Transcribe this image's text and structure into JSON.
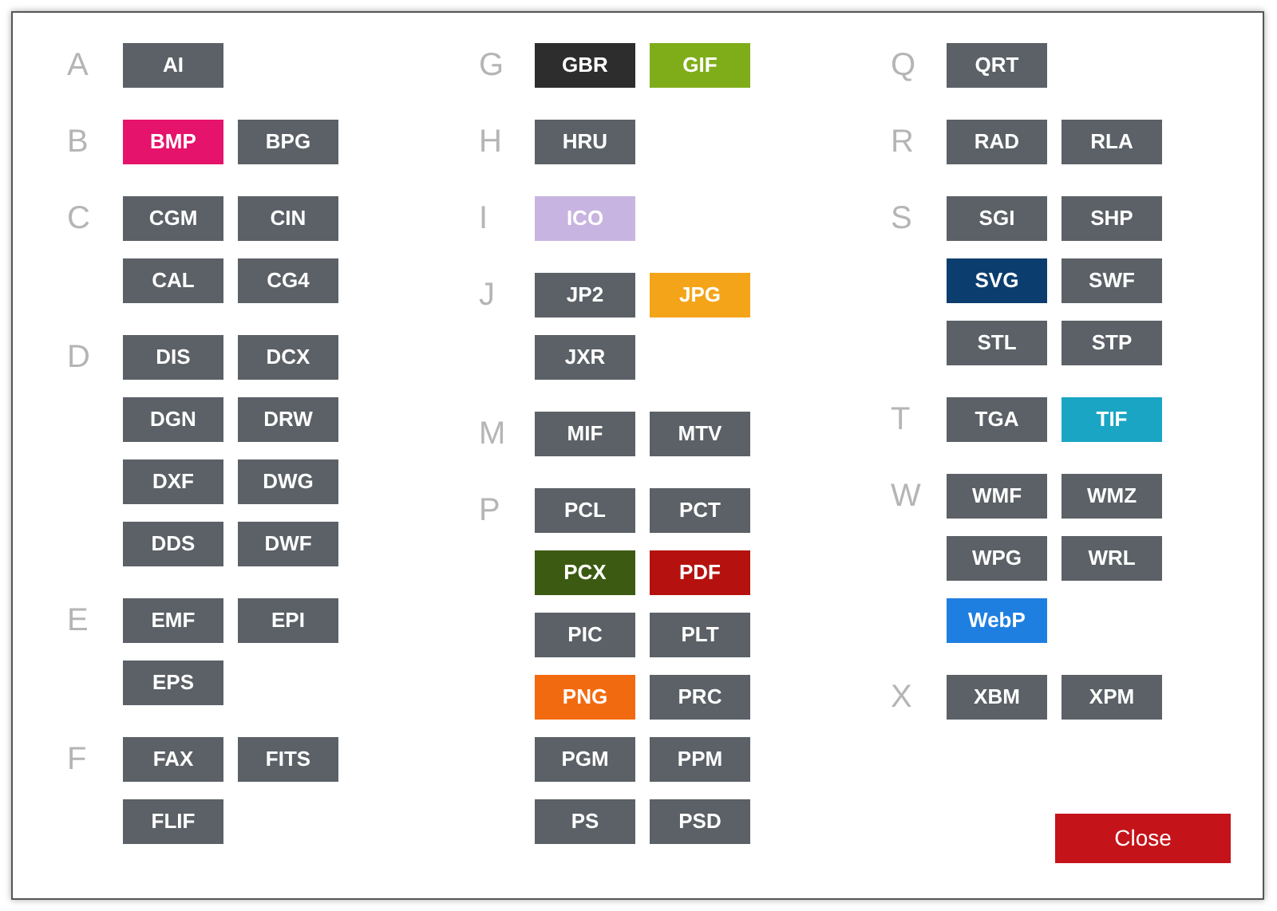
{
  "columns": [
    {
      "groups": [
        {
          "letter": "A",
          "formats": [
            {
              "label": "AI",
              "color": "#5b6166"
            }
          ]
        },
        {
          "letter": "B",
          "formats": [
            {
              "label": "BMP",
              "color": "#e5136b"
            },
            {
              "label": "BPG",
              "color": "#5b6166"
            }
          ]
        },
        {
          "letter": "C",
          "formats": [
            {
              "label": "CGM",
              "color": "#5b6166"
            },
            {
              "label": "CIN",
              "color": "#5b6166"
            },
            {
              "label": "CAL",
              "color": "#5b6166"
            },
            {
              "label": "CG4",
              "color": "#5b6166"
            }
          ]
        },
        {
          "letter": "D",
          "formats": [
            {
              "label": "DIS",
              "color": "#5b6166"
            },
            {
              "label": "DCX",
              "color": "#5b6166"
            },
            {
              "label": "DGN",
              "color": "#5b6166"
            },
            {
              "label": "DRW",
              "color": "#5b6166"
            },
            {
              "label": "DXF",
              "color": "#5b6166"
            },
            {
              "label": "DWG",
              "color": "#5b6166"
            },
            {
              "label": "DDS",
              "color": "#5b6166"
            },
            {
              "label": "DWF",
              "color": "#5b6166"
            }
          ]
        },
        {
          "letter": "E",
          "formats": [
            {
              "label": "EMF",
              "color": "#5b6166"
            },
            {
              "label": "EPI",
              "color": "#5b6166"
            },
            {
              "label": "EPS",
              "color": "#5b6166"
            }
          ]
        },
        {
          "letter": "F",
          "formats": [
            {
              "label": "FAX",
              "color": "#5b6166"
            },
            {
              "label": "FITS",
              "color": "#5b6166"
            },
            {
              "label": "FLIF",
              "color": "#5b6166"
            }
          ]
        }
      ]
    },
    {
      "groups": [
        {
          "letter": "G",
          "formats": [
            {
              "label": "GBR",
              "color": "#2d2d2d"
            },
            {
              "label": "GIF",
              "color": "#7fad1a"
            }
          ]
        },
        {
          "letter": "H",
          "formats": [
            {
              "label": "HRU",
              "color": "#5b6166"
            }
          ]
        },
        {
          "letter": "I",
          "formats": [
            {
              "label": "ICO",
              "color": "#c8b4e0"
            }
          ]
        },
        {
          "letter": "J",
          "formats": [
            {
              "label": "JP2",
              "color": "#5b6166"
            },
            {
              "label": "JPG",
              "color": "#f4a419"
            },
            {
              "label": "JXR",
              "color": "#5b6166"
            }
          ]
        },
        {
          "letter": "M",
          "formats": [
            {
              "label": "MIF",
              "color": "#5b6166"
            },
            {
              "label": "MTV",
              "color": "#5b6166"
            }
          ]
        },
        {
          "letter": "P",
          "formats": [
            {
              "label": "PCL",
              "color": "#5b6166"
            },
            {
              "label": "PCT",
              "color": "#5b6166"
            },
            {
              "label": "PCX",
              "color": "#3c5a12"
            },
            {
              "label": "PDF",
              "color": "#b5120f"
            },
            {
              "label": "PIC",
              "color": "#5b6166"
            },
            {
              "label": "PLT",
              "color": "#5b6166"
            },
            {
              "label": "PNG",
              "color": "#f26a0f"
            },
            {
              "label": "PRC",
              "color": "#5b6166"
            },
            {
              "label": "PGM",
              "color": "#5b6166"
            },
            {
              "label": "PPM",
              "color": "#5b6166"
            },
            {
              "label": "PS",
              "color": "#5b6166"
            },
            {
              "label": "PSD",
              "color": "#5b6166"
            }
          ]
        }
      ]
    },
    {
      "groups": [
        {
          "letter": "Q",
          "formats": [
            {
              "label": "QRT",
              "color": "#5b6166"
            }
          ]
        },
        {
          "letter": "R",
          "formats": [
            {
              "label": "RAD",
              "color": "#5b6166"
            },
            {
              "label": "RLA",
              "color": "#5b6166"
            }
          ]
        },
        {
          "letter": "S",
          "formats": [
            {
              "label": "SGI",
              "color": "#5b6166"
            },
            {
              "label": "SHP",
              "color": "#5b6166"
            },
            {
              "label": "SVG",
              "color": "#0b3e6e"
            },
            {
              "label": "SWF",
              "color": "#5b6166"
            },
            {
              "label": "STL",
              "color": "#5b6166"
            },
            {
              "label": "STP",
              "color": "#5b6166"
            }
          ]
        },
        {
          "letter": "T",
          "formats": [
            {
              "label": "TGA",
              "color": "#5b6166"
            },
            {
              "label": "TIF",
              "color": "#1aa5c4"
            }
          ]
        },
        {
          "letter": "W",
          "formats": [
            {
              "label": "WMF",
              "color": "#5b6166"
            },
            {
              "label": "WMZ",
              "color": "#5b6166"
            },
            {
              "label": "WPG",
              "color": "#5b6166"
            },
            {
              "label": "WRL",
              "color": "#5b6166"
            },
            {
              "label": "WebP",
              "color": "#1f7fe0"
            }
          ]
        },
        {
          "letter": "X",
          "formats": [
            {
              "label": "XBM",
              "color": "#5b6166"
            },
            {
              "label": "XPM",
              "color": "#5b6166"
            }
          ]
        }
      ]
    }
  ],
  "close_button": {
    "label": "Close"
  }
}
